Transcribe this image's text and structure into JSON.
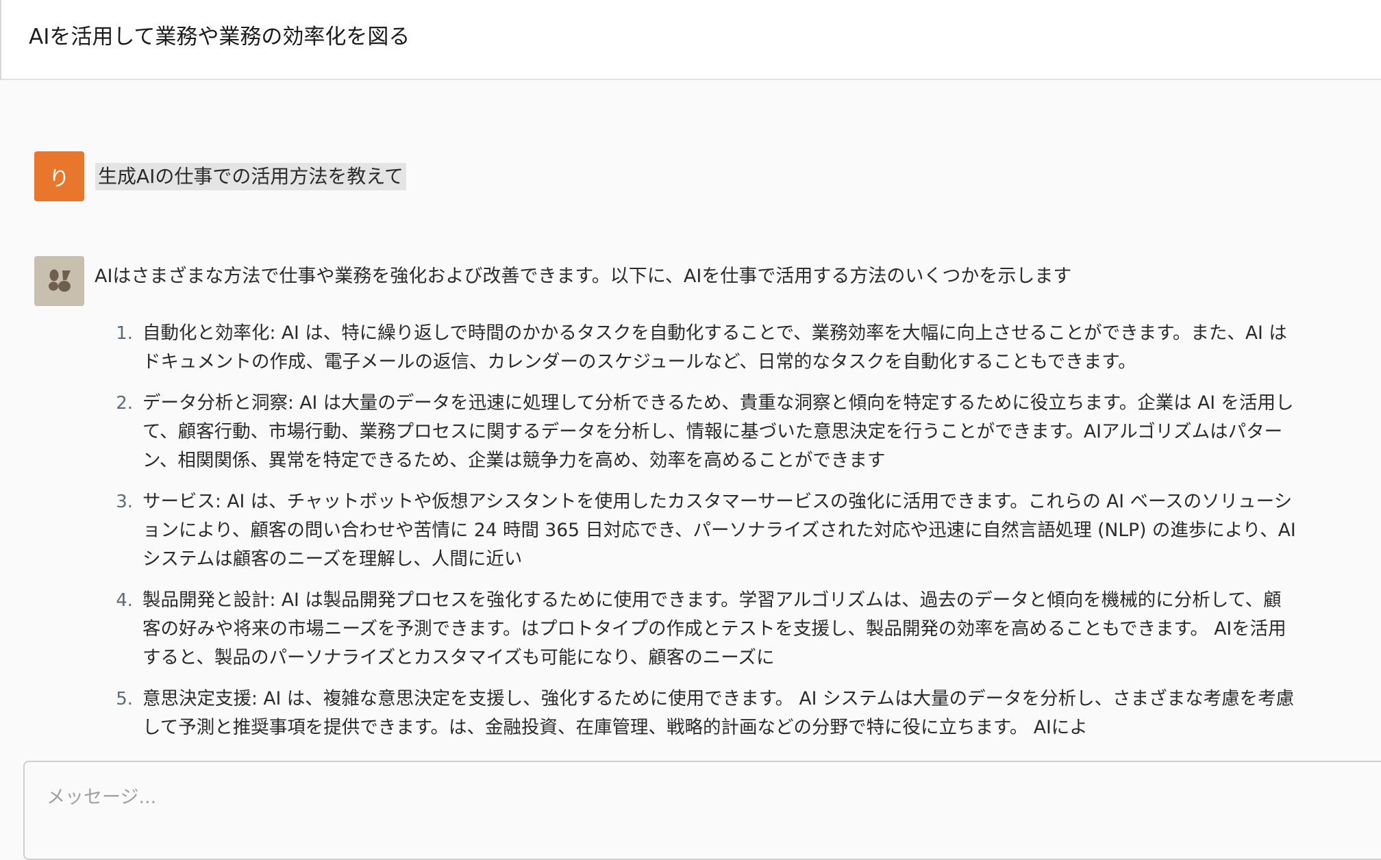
{
  "header": {
    "title": "AIを活用して業務や業務の効率化を図る"
  },
  "conversation": {
    "user_message": {
      "avatar_initial": "り",
      "text": "生成AIの仕事での活用方法を教えて"
    },
    "assistant_message": {
      "intro": "AIはさまざまな方法で仕事や業務を強化および改善できます。以下に、AIを仕事で活用する方法のいくつかを示します",
      "items": [
        {
          "number": "1.",
          "text": "自動化と効率化: AI は、特に繰り返しで時間のかかるタスクを自動化することで、業務効率を大幅に向上させることができます。また、AI はドキュメントの作成、電子メールの返信、カレンダーのスケジュールなど、日常的なタスクを自動化することもできます。"
        },
        {
          "number": "2.",
          "text": "データ分析と洞察: AI は大量のデータを迅速に処理して分析できるため、貴重な洞察と傾向を特定するために役立ちます。企業は AI を活用して、顧客行動、市場行動、業務プロセスに関するデータを分析し、情報に基づいた意思決定を行うことができます。AIアルゴリズムはパターン、相関関係、異常を特定できるため、企業は競争力を高め、効率を高めることができます"
        },
        {
          "number": "3.",
          "text": "サービス: AI は、チャットボットや仮想アシスタントを使用したカスタマーサービスの強化に活用できます。これらの AI ベースのソリューションにより、顧客の問い合わせや苦情に 24 時間 365 日対応でき、パーソナライズされた対応や迅速に自然言語処理 (NLP) の進歩により、AI システムは顧客のニーズを理解し、人間に近い"
        },
        {
          "number": "4.",
          "text": "製品開発と設計: AI は製品開発プロセスを強化するために使用できます。学習アルゴリズムは、過去のデータと傾向を機械的に分析して、顧客の好みや将来の市場ニーズを予測できます。はプロトタイプの作成とテストを支援し、製品開発の効率を高めることもできます。 AIを活用すると、製品のパーソナライズとカスタマイズも可能になり、顧客のニーズに"
        },
        {
          "number": "5.",
          "text": "意思決定支援: AI は、複雑な意思決定を支援し、強化するために使用できます。 AI システムは大量のデータを分析し、さまざまな考慮を考慮して予測と推奨事項を提供できます。は、金融投資、在庫管理、戦略的計画などの分野で特に役に立ちます。 AIによ"
        }
      ]
    }
  },
  "composer": {
    "placeholder": "メッセージ...",
    "value": ""
  },
  "colors": {
    "user_avatar": "#e8762c",
    "assistant_avatar": "#c9bfaf",
    "user_bubble": "#e4e4e4",
    "list_number": "#5b6b7c"
  },
  "icons": {
    "assistant_avatar": "claude-logo-icon"
  }
}
